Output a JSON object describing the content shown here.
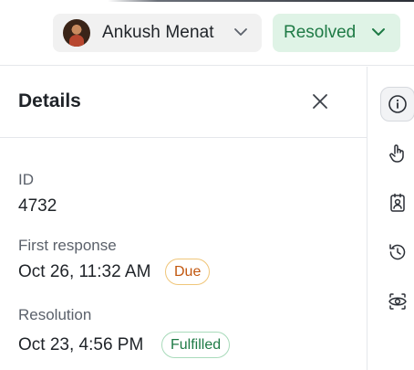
{
  "header": {
    "assignee": {
      "name": "Ankush Menat",
      "avatar_icon": "user-avatar",
      "dropdown_icon": "chevron-down-icon"
    },
    "status": {
      "label": "Resolved",
      "color": "#1e7a45",
      "background": "#dff3e6",
      "dropdown_icon": "chevron-down-icon"
    }
  },
  "details": {
    "title": "Details",
    "close_icon": "close-icon",
    "fields": {
      "id": {
        "label": "ID",
        "value": "4732"
      },
      "first_response": {
        "label": "First response",
        "value": "Oct 26, 11:32 AM",
        "badge": "Due",
        "badge_color": "#c2570f"
      },
      "resolution": {
        "label": "Resolution",
        "value": "Oct 23, 4:56 PM",
        "badge": "Fulfilled",
        "badge_color": "#1e7a45"
      }
    }
  },
  "rail": {
    "items": [
      {
        "icon": "info-icon",
        "active": true
      },
      {
        "icon": "hand-pointer-icon",
        "active": false
      },
      {
        "icon": "contact-card-icon",
        "active": false
      },
      {
        "icon": "history-icon",
        "active": false
      },
      {
        "icon": "eye-icon",
        "active": false
      }
    ]
  }
}
